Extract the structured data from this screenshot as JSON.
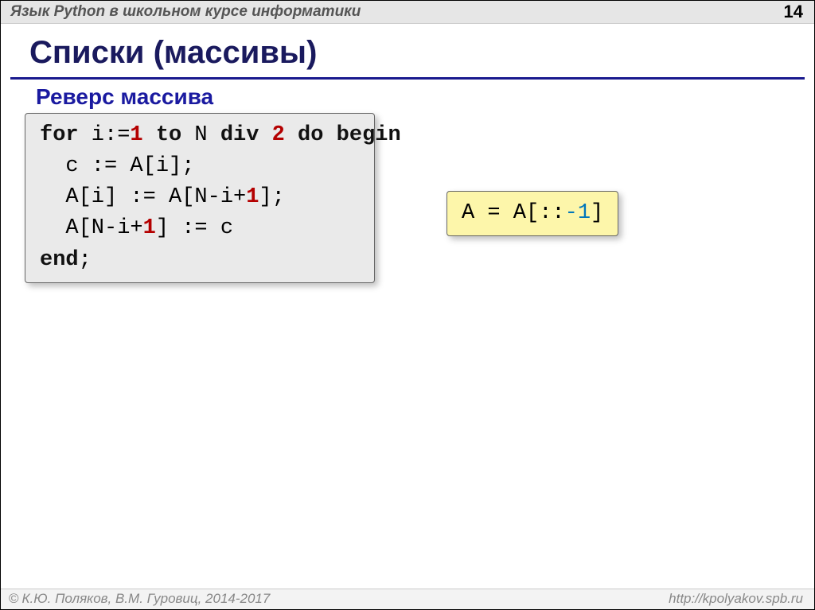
{
  "header": {
    "title": "Язык Python в школьном курсе информатики",
    "page_number": "14"
  },
  "main_title": "Списки (массивы)",
  "subtitle": "Реверс массива",
  "pascal": {
    "kw_for": "for",
    "var_i": " i:=",
    "num_1": "1",
    "kw_to": " to",
    "mid_n": " N ",
    "kw_div": "div",
    "sp": " ",
    "num_2": "2",
    "kw_do": " do begin",
    "line2": "  c := A[i];",
    "line3_a": "  A[i] := A[N-i+",
    "num_1b": "1",
    "line3_b": "];",
    "line4_a": "  A[N-i+",
    "num_1c": "1",
    "line4_b": "] := c",
    "kw_end": "end",
    "semi": ";"
  },
  "python": {
    "text_a": "A = A[::",
    "minus1": "-1",
    "text_b": "]"
  },
  "footer": {
    "copyright": "К.Ю. Поляков, В.М. Гуровиц, 2014-2017",
    "url": "http://kpolyakov.spb.ru"
  }
}
